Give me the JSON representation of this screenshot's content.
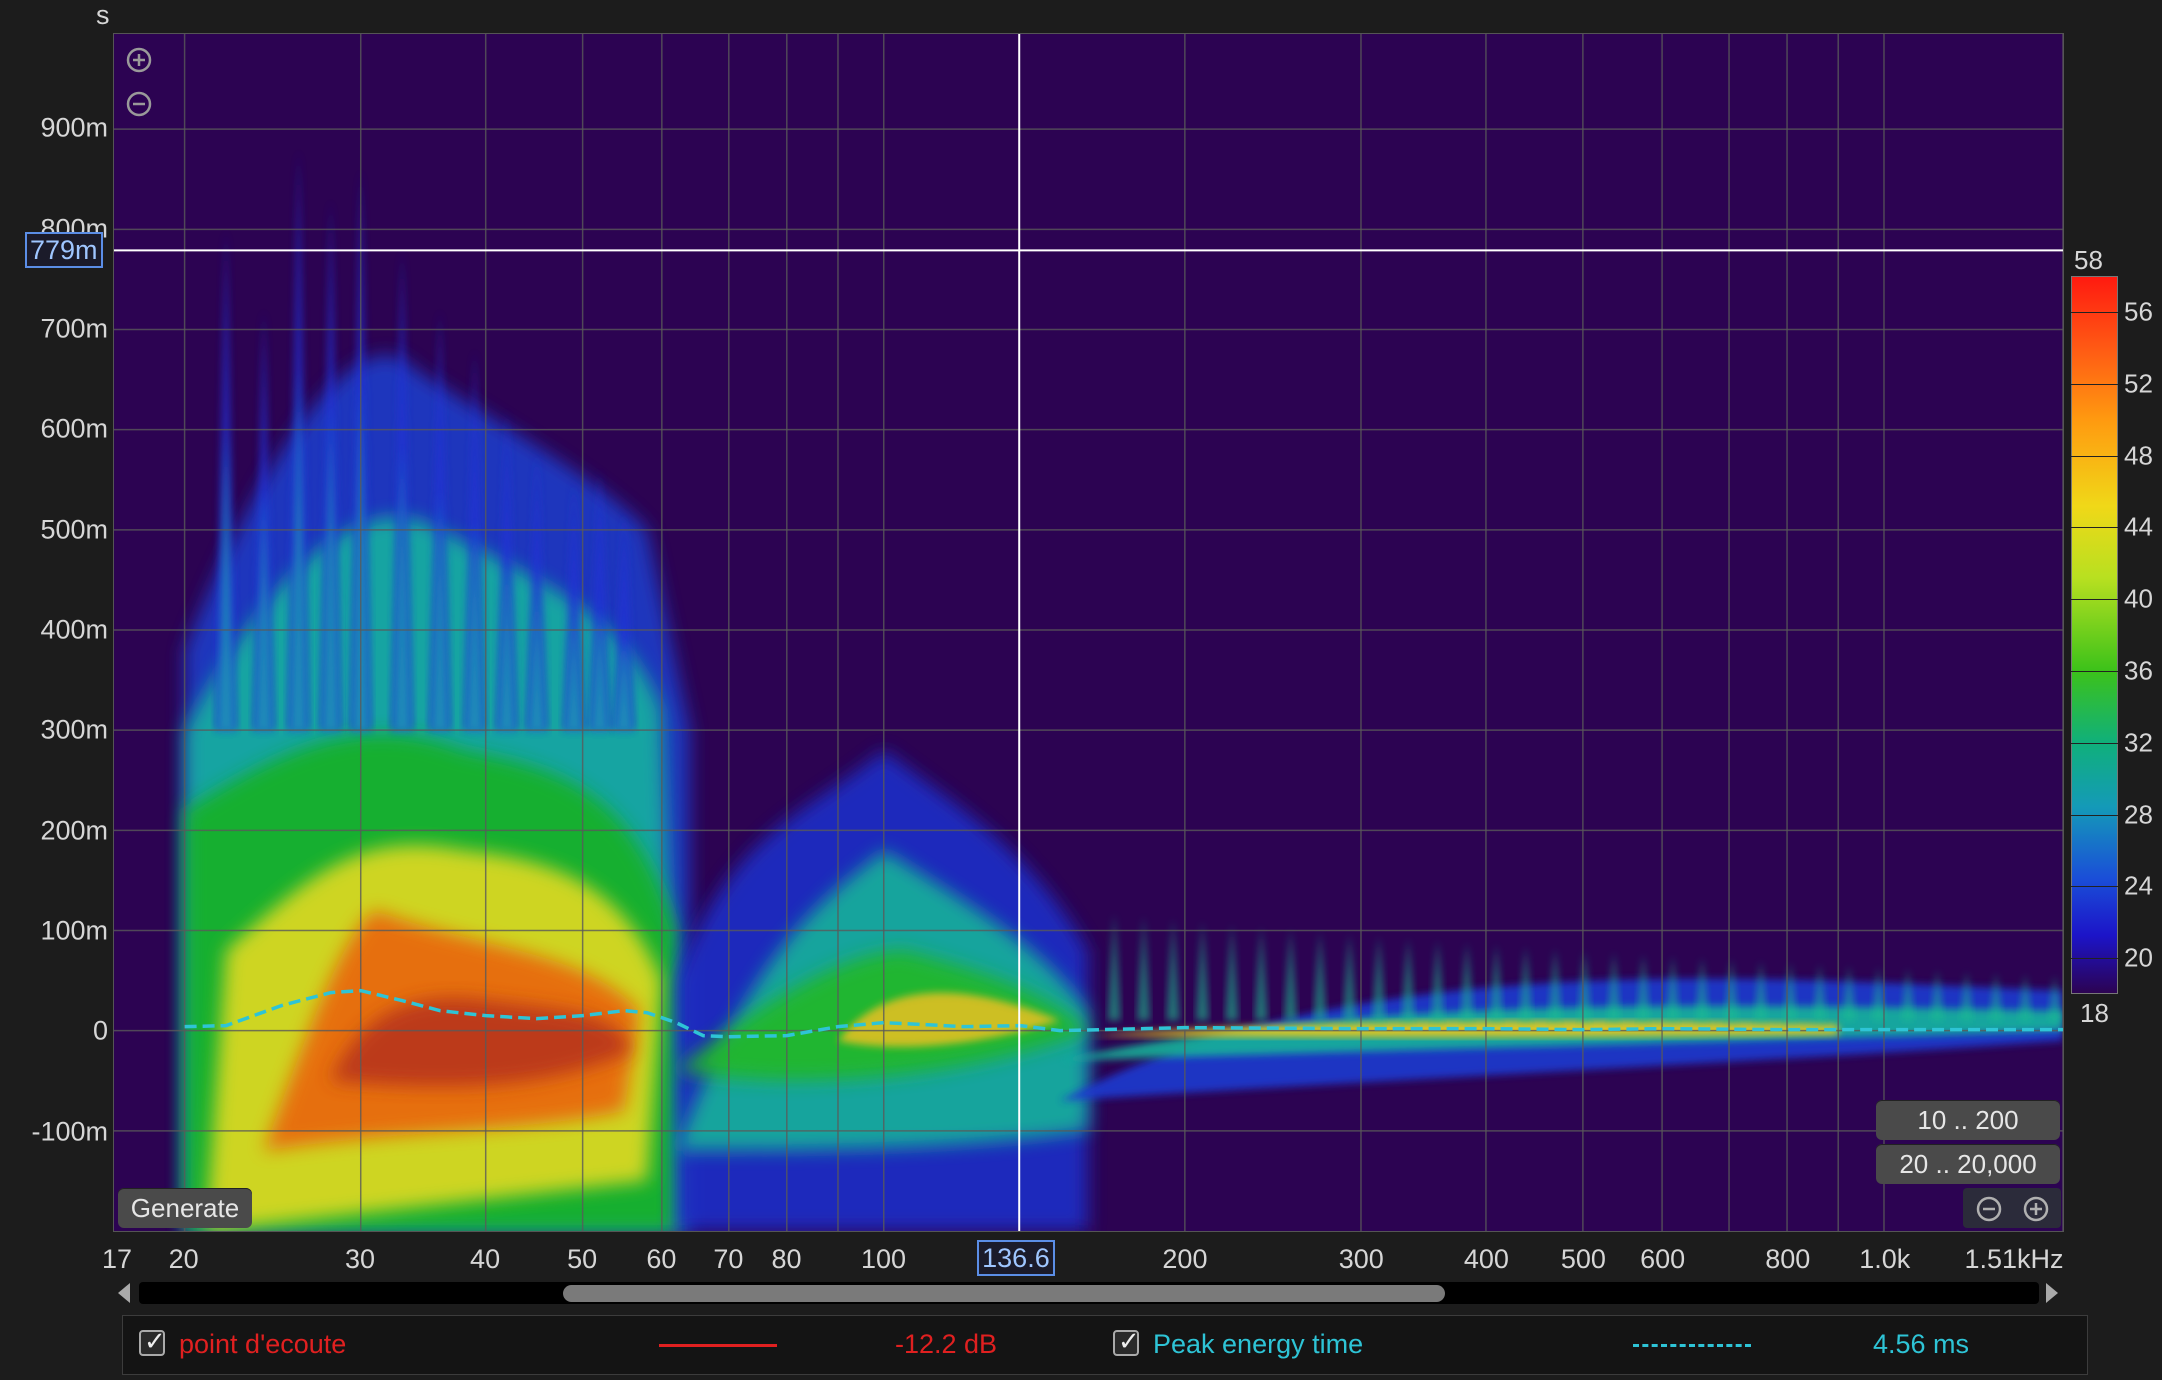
{
  "axes": {
    "y_unit": "s",
    "y_ticks": [
      {
        "label": "900m",
        "value": 0.9
      },
      {
        "label": "800m",
        "value": 0.8
      },
      {
        "label": "700m",
        "value": 0.7
      },
      {
        "label": "600m",
        "value": 0.6
      },
      {
        "label": "500m",
        "value": 0.5
      },
      {
        "label": "400m",
        "value": 0.4
      },
      {
        "label": "300m",
        "value": 0.3
      },
      {
        "label": "200m",
        "value": 0.2
      },
      {
        "label": "100m",
        "value": 0.1
      },
      {
        "label": "0",
        "value": 0
      },
      {
        "label": "-100m",
        "value": -0.1
      }
    ],
    "x_ticks": [
      {
        "label": "17",
        "value": 17
      },
      {
        "label": "20",
        "value": 20
      },
      {
        "label": "30",
        "value": 30
      },
      {
        "label": "40",
        "value": 40
      },
      {
        "label": "50",
        "value": 50
      },
      {
        "label": "60",
        "value": 60
      },
      {
        "label": "70",
        "value": 70
      },
      {
        "label": "80",
        "value": 80
      },
      {
        "label": "100",
        "value": 100
      },
      {
        "label": "200",
        "value": 200
      },
      {
        "label": "300",
        "value": 300
      },
      {
        "label": "400",
        "value": 400
      },
      {
        "label": "500",
        "value": 500
      },
      {
        "label": "600",
        "value": 600
      },
      {
        "label": "800",
        "value": 800
      },
      {
        "label": "1.0k",
        "value": 1000
      },
      {
        "label": "1.51kHz",
        "value": 1510
      }
    ],
    "x_range": [
      17,
      1510
    ],
    "y_range": [
      -0.2,
      0.995
    ],
    "x_scale": "log"
  },
  "cursor": {
    "x_label": "136.6",
    "x_value": 136.6,
    "y_label": "779m",
    "y_value": 0.779
  },
  "colorbar": {
    "max_label": "58",
    "min_label": "18",
    "ticks": [
      {
        "label": "56",
        "value": 56
      },
      {
        "label": "52",
        "value": 52
      },
      {
        "label": "48",
        "value": 48
      },
      {
        "label": "44",
        "value": 44
      },
      {
        "label": "40",
        "value": 40
      },
      {
        "label": "36",
        "value": 36
      },
      {
        "label": "32",
        "value": 32
      },
      {
        "label": "28",
        "value": 28
      },
      {
        "label": "24",
        "value": 24
      },
      {
        "label": "20",
        "value": 20
      }
    ],
    "range": [
      18,
      58
    ]
  },
  "controls": {
    "generate_label": "Generate",
    "range_1_label": "10 .. 200",
    "range_2_label": "20 .. 20,000"
  },
  "legend": {
    "series_1": {
      "name": "point d'ecoute",
      "value": "-12.2 dB",
      "color": "#e02020",
      "checked": true
    },
    "series_2": {
      "name": "Peak energy time",
      "value": "4.56 ms",
      "color": "#2ec4d6",
      "checked": true
    }
  },
  "colors": {
    "plot_background": "#2c0352",
    "peak_line": "#2ec4d6"
  },
  "chart_data": {
    "type": "heatmap",
    "title": "",
    "xlabel": "",
    "ylabel": "s",
    "x_scale": "log",
    "xlim": [
      17,
      1510
    ],
    "ylim": [
      -0.2,
      0.995
    ],
    "zlim": [
      18,
      58
    ],
    "series": [
      {
        "name": "Peak energy time",
        "x": [
          20,
          22,
          25,
          28,
          30,
          33,
          36,
          40,
          45,
          50,
          55,
          58,
          62,
          66,
          70,
          80,
          90,
          100,
          110,
          120,
          137,
          150,
          200,
          300,
          400,
          500,
          600,
          800,
          1000,
          1510
        ],
        "y": [
          0.004,
          0.005,
          0.025,
          0.038,
          0.04,
          0.03,
          0.02,
          0.015,
          0.012,
          0.015,
          0.02,
          0.018,
          0.008,
          -0.005,
          -0.006,
          -0.005,
          0.004,
          0.008,
          0.006,
          0.004,
          0.005,
          0.0,
          0.003,
          0.002,
          0.002,
          0.001,
          0.002,
          0.001,
          0.001,
          0.001
        ]
      }
    ]
  }
}
